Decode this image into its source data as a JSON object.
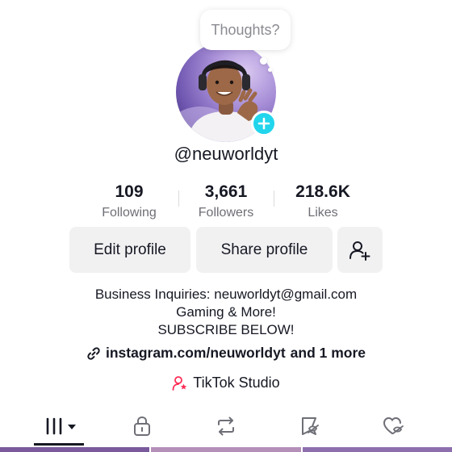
{
  "profile": {
    "thought_bubble": "Thoughts?",
    "username": "@neuworldyt",
    "stats": [
      {
        "value": "109",
        "label": "Following"
      },
      {
        "value": "3,661",
        "label": "Followers"
      },
      {
        "value": "218.6K",
        "label": "Likes"
      }
    ],
    "buttons": {
      "edit": "Edit profile",
      "share": "Share profile"
    },
    "bio": [
      "Business Inquiries: neuworldyt@gmail.com",
      "Gaming & More!",
      "SUBSCRIBE BELOW!"
    ],
    "link": {
      "url": "instagram.com/neuworldyt",
      "more": "and 1 more"
    },
    "studio_label": "TikTok Studio"
  },
  "tabs": [
    "videos-grid",
    "private",
    "reposts",
    "favorites",
    "liked"
  ],
  "colors": {
    "accent_cyan": "#20d5ec",
    "studio_pink": "#fe2c55",
    "button_bg": "#f1f1f2",
    "text_primary": "#161823",
    "text_secondary": "#6e6f76"
  }
}
